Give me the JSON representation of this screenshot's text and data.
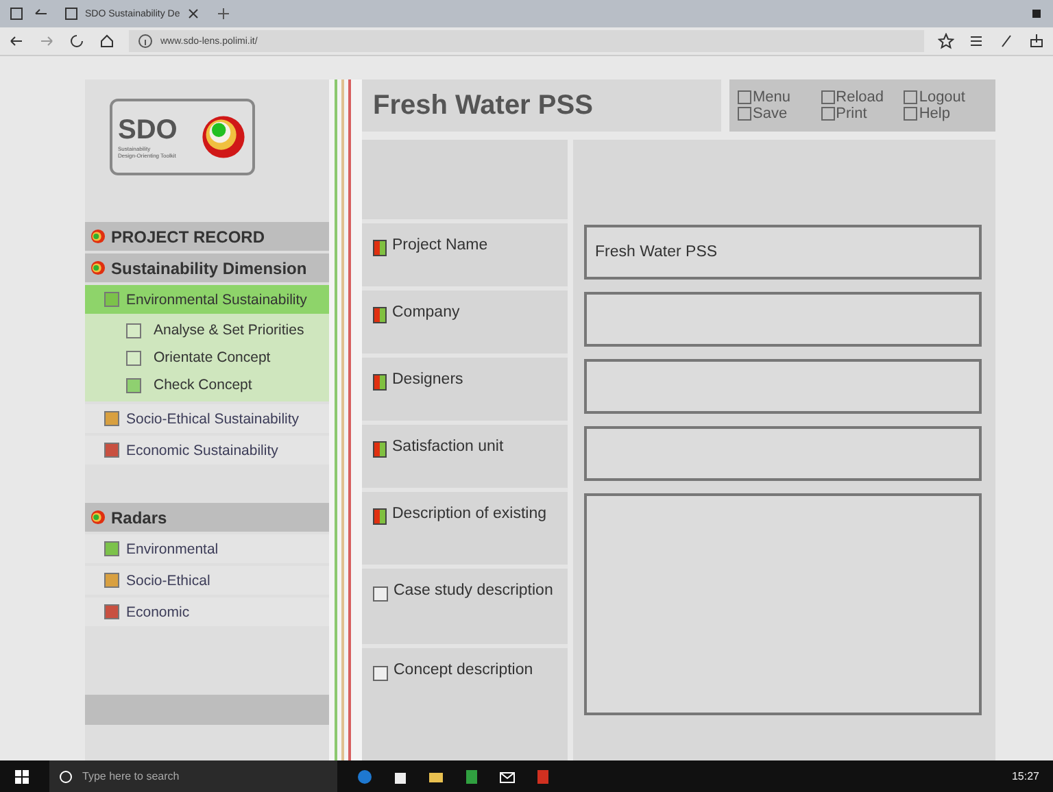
{
  "browser": {
    "tab_title": "SDO  Sustainability De",
    "url": "www.sdo-lens.polimi.it/"
  },
  "logo": {
    "title": "SDO",
    "subtitle": "Sustainability\nDesign-Orienting Toolkit"
  },
  "sidebar": [
    {
      "title": "PROJECT RECORD"
    },
    {
      "title": "Sustainability Dimension",
      "items": [
        {
          "label": "Environmental Sustainability",
          "color": "#7cc24a",
          "selected": true,
          "children": [
            {
              "label": "Analyse & Set Priorities",
              "color": "#d6ebc6"
            },
            {
              "label": "Orientate Concept",
              "color": "#d6ebc6"
            },
            {
              "label": "Check Concept",
              "color": "#8fd070"
            }
          ]
        },
        {
          "label": "Socio-Ethical Sustainability",
          "color": "#d8a040",
          "selected": false
        },
        {
          "label": "Economic Sustainability",
          "color": "#c85040",
          "selected": false
        }
      ]
    },
    {
      "title": "Radars",
      "items": [
        {
          "label": "Environmental",
          "color": "#7cc24a",
          "selected": false
        },
        {
          "label": "Socio-Ethical",
          "color": "#d8a040",
          "selected": false
        },
        {
          "label": "Economic",
          "color": "#c85040",
          "selected": false
        }
      ]
    }
  ],
  "header": {
    "title": "Fresh Water PSS",
    "menu": [
      {
        "label": "Menu"
      },
      {
        "label": "Reload"
      },
      {
        "label": "Logout"
      },
      {
        "label": "Save"
      },
      {
        "label": "Print"
      },
      {
        "label": "Help"
      }
    ]
  },
  "form": {
    "fields": [
      {
        "label": "Project Name",
        "kind": "status",
        "value": "Fresh Water PSS"
      },
      {
        "label": "Company",
        "kind": "status"
      },
      {
        "label": "Designers",
        "kind": "status"
      },
      {
        "label": "Satisfaction unit",
        "kind": "status"
      },
      {
        "label": "Description of existing",
        "kind": "status"
      },
      {
        "label": "Case study description",
        "kind": "checkbox",
        "checked": false
      },
      {
        "label": "Concept description",
        "kind": "checkbox",
        "checked": false
      }
    ]
  },
  "taskbar": {
    "search_placeholder": "Type here to search",
    "time": "15:27"
  }
}
